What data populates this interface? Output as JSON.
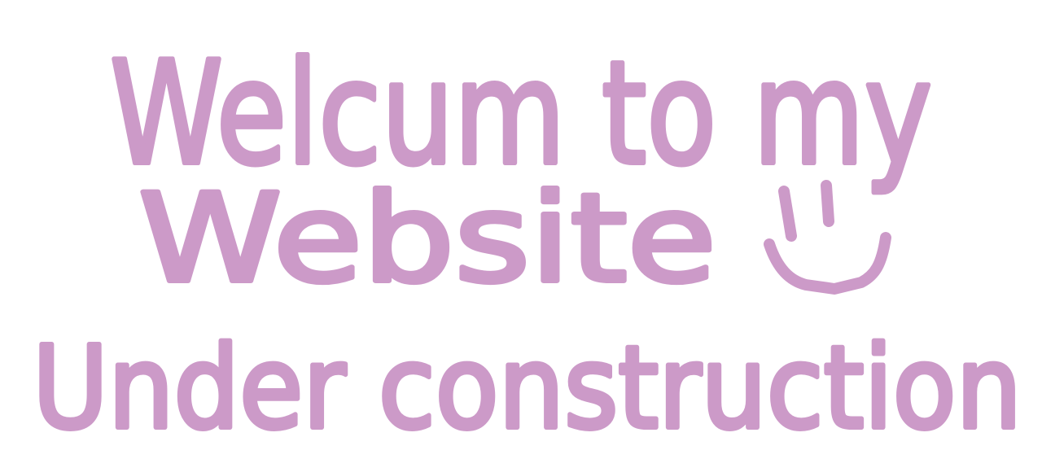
{
  "lines": {
    "greeting": "Welcum to my",
    "site": "Website",
    "status": "Under construction"
  },
  "smiley_icon": "smiley-face-icon",
  "ink_color": "#cc9ac8"
}
